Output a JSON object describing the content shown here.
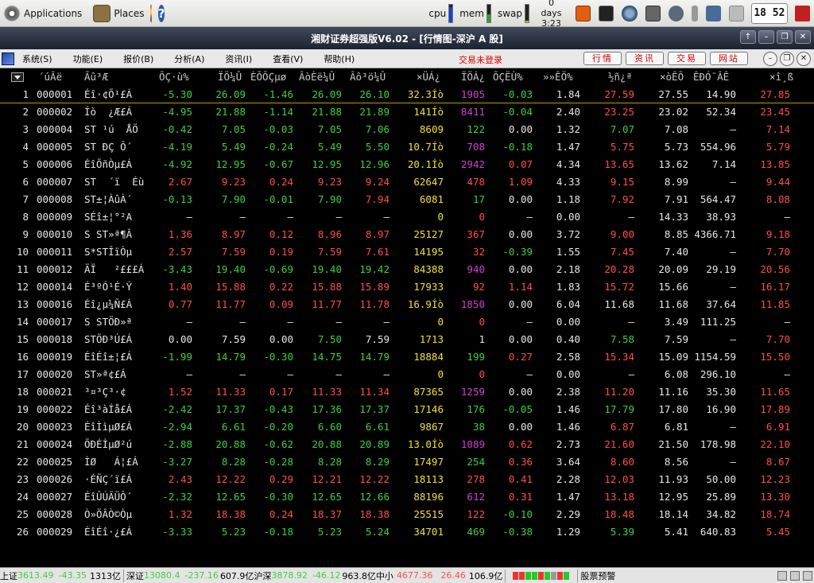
{
  "panel": {
    "applications": "Applications",
    "places": "Places",
    "cpu": "cpu",
    "mem": "mem",
    "swap": "swap",
    "uptime_days": "0 days",
    "uptime_time": "3:23",
    "clock": "18 52"
  },
  "window": {
    "title": "湘财证券超强版V6.02 - [行情图-深沪 A 股]",
    "buttons": [
      "↑",
      "–",
      "❐",
      "✕"
    ]
  },
  "menu": {
    "items": [
      "系统(S)",
      "功能(E)",
      "报价(B)",
      "分析(A)",
      "资讯(I)",
      "查看(V)",
      "帮助(H)"
    ],
    "login_status": "交易未登录",
    "right_buttons": [
      "行情",
      "资讯",
      "交易",
      "网站"
    ],
    "win_buttons": [
      "–",
      "❐",
      "✕"
    ]
  },
  "table": {
    "headers": [
      "´úÂë",
      "Ãû³Æ",
      "ÕÇ·ù%",
      "ÏÖ¼Û",
      "ÈÕÕÇµø",
      "ÂòÈë¼Û",
      "Âô³ö¼Û",
      "×ÜÁ¿",
      "ÏÖÁ¿",
      "ÕÇËÙ%",
      "»»ÊÖ%",
      "½ñ¿ª",
      "×òÊÕ",
      "ÊÐÓ¯ÂÊ",
      "×î¸ß"
    ],
    "rows": [
      [
        "1",
        "000001",
        "Éî·¢Õ¹£Á",
        "-5.30",
        "26.09",
        "-1.46",
        "26.09",
        "26.10",
        "32.3Íò",
        "1905",
        "-0.03",
        "1.84",
        "27.59",
        "27.55",
        "14.90",
        "27.85"
      ],
      [
        "2",
        "000002",
        "Íò  ¿Æ£Á",
        "-4.95",
        "21.88",
        "-1.14",
        "21.88",
        "21.89",
        "141Íò",
        "8411",
        "-0.04",
        "2.40",
        "23.25",
        "23.02",
        "52.34",
        "23.45"
      ],
      [
        "3",
        "000004",
        "ST ¹ú  ÅÖ",
        "-0.42",
        "7.05",
        "-0.03",
        "7.05",
        "7.06",
        "8609",
        "122",
        "0.00",
        "1.32",
        "7.07",
        "7.08",
        "—",
        "7.14"
      ],
      [
        "4",
        "000005",
        "ST ÐÇ Ô´",
        "-4.19",
        "5.49",
        "-0.24",
        "5.49",
        "5.50",
        "10.7Íò",
        "708",
        "-0.18",
        "1.47",
        "5.75",
        "5.73",
        "554.96",
        "5.79"
      ],
      [
        "5",
        "000006",
        "ÉîÕñÒµ£Á",
        "-4.92",
        "12.95",
        "-0.67",
        "12.95",
        "12.96",
        "20.1Íò",
        "2942",
        "0.07",
        "4.34",
        "13.65",
        "13.62",
        "7.14",
        "13.85"
      ],
      [
        "6",
        "000007",
        "ST  ´ï  Éù",
        "2.67",
        "9.23",
        "0.24",
        "9.23",
        "9.24",
        "62647",
        "478",
        "1.09",
        "4.33",
        "9.15",
        "8.99",
        "—",
        "9.44"
      ],
      [
        "7",
        "000008",
        "ST±¦ÀûÀ´",
        "-0.13",
        "7.90",
        "-0.01",
        "7.90",
        "7.94",
        "6081",
        "17",
        "0.00",
        "1.18",
        "7.92",
        "7.91",
        "564.47",
        "8.08"
      ],
      [
        "8",
        "000009",
        "SÉî±¦°²A",
        "—",
        "—",
        "—",
        "—",
        "—",
        "0",
        "0",
        "—",
        "0.00",
        "—",
        "14.33",
        "38.93",
        "—"
      ],
      [
        "9",
        "000010",
        "S ST»ª¶Â",
        "1.36",
        "8.97",
        "0.12",
        "8.96",
        "8.97",
        "25127",
        "367",
        "0.00",
        "3.72",
        "9.00",
        "8.85",
        "4366.71",
        "9.18"
      ],
      [
        "10",
        "000011",
        "S*STÎïÒµ",
        "2.57",
        "7.59",
        "0.19",
        "7.59",
        "7.61",
        "14195",
        "32",
        "-0.39",
        "1.55",
        "7.45",
        "7.40",
        "—",
        "7.70"
      ],
      [
        "11",
        "000012",
        "ÄÏ   ²£££Á",
        "-3.43",
        "19.40",
        "-0.69",
        "19.40",
        "19.42",
        "84388",
        "940",
        "0.00",
        "2.18",
        "20.28",
        "20.09",
        "29.19",
        "20.56"
      ],
      [
        "12",
        "000014",
        "É³ºÓ¹É·Ý",
        "1.40",
        "15.88",
        "0.22",
        "15.88",
        "15.89",
        "17933",
        "92",
        "1.14",
        "1.83",
        "15.72",
        "15.66",
        "—",
        "16.17"
      ],
      [
        "13",
        "000016",
        "Éî¿µ¼Ñ£Á",
        "0.77",
        "11.77",
        "0.09",
        "11.77",
        "11.78",
        "16.9Íò",
        "1850",
        "0.00",
        "6.04",
        "11.68",
        "11.68",
        "37.64",
        "11.85"
      ],
      [
        "14",
        "000017",
        "S STÖÐ»ª",
        "—",
        "—",
        "—",
        "—",
        "—",
        "0",
        "0",
        "—",
        "0.00",
        "—",
        "3.49",
        "111.25",
        "—"
      ],
      [
        "15",
        "000018",
        "STÖÐ³Ú£Á",
        "0.00",
        "7.59",
        "0.00",
        "7.50",
        "7.59",
        "1713",
        "1",
        "0.00",
        "0.40",
        "7.58",
        "7.59",
        "—",
        "7.70"
      ],
      [
        "16",
        "000019",
        "ÉîÉî±¦£Á",
        "-1.99",
        "14.79",
        "-0.30",
        "14.75",
        "14.79",
        "18884",
        "199",
        "0.27",
        "2.58",
        "15.34",
        "15.09",
        "1154.59",
        "15.50"
      ],
      [
        "17",
        "000020",
        "ST»ª¢£Á",
        "—",
        "—",
        "—",
        "—",
        "—",
        "0",
        "0",
        "—",
        "0.00",
        "—",
        "6.08",
        "296.10",
        "—"
      ],
      [
        "18",
        "000021",
        "³¤³Ç³·¢",
        "1.52",
        "11.33",
        "0.17",
        "11.33",
        "11.34",
        "87365",
        "1259",
        "0.00",
        "2.38",
        "11.20",
        "11.16",
        "35.30",
        "11.65"
      ],
      [
        "19",
        "000022",
        "Éî³àÍå£Á",
        "-2.42",
        "17.37",
        "-0.43",
        "17.36",
        "17.37",
        "17146",
        "176",
        "-0.05",
        "1.46",
        "17.79",
        "17.80",
        "16.90",
        "17.89"
      ],
      [
        "20",
        "000023",
        "ÉîÌìµØ£Á",
        "-2.94",
        "6.61",
        "-0.20",
        "6.60",
        "6.61",
        "9867",
        "38",
        "0.00",
        "1.46",
        "6.87",
        "6.81",
        "—",
        "6.91"
      ],
      [
        "21",
        "000024",
        "ÕÐÉÌµØ²ú",
        "-2.88",
        "20.88",
        "-0.62",
        "20.88",
        "20.89",
        "13.0Íò",
        "1089",
        "0.62",
        "2.73",
        "21.60",
        "21.50",
        "178.98",
        "22.10"
      ],
      [
        "22",
        "000025",
        "ÌØ   Á¦£Á",
        "-3.27",
        "8.28",
        "-0.28",
        "8.28",
        "8.29",
        "17497",
        "254",
        "0.36",
        "3.64",
        "8.60",
        "8.56",
        "—",
        "8.67"
      ],
      [
        "23",
        "000026",
        "·ÉÑÇ´ï£Á",
        "2.43",
        "12.22",
        "0.29",
        "12.21",
        "12.22",
        "18113",
        "278",
        "0.41",
        "2.28",
        "12.03",
        "11.93",
        "50.00",
        "12.23"
      ],
      [
        "24",
        "000027",
        "ÉîÛÚÄÜÔ´",
        "-2.32",
        "12.65",
        "-0.30",
        "12.65",
        "12.66",
        "88196",
        "612",
        "0.31",
        "1.47",
        "13.18",
        "12.95",
        "25.89",
        "13.30"
      ],
      [
        "25",
        "000028",
        "Ò»ÖÂÒ©Òµ",
        "1.32",
        "18.38",
        "0.24",
        "18.37",
        "18.38",
        "25515",
        "122",
        "-0.10",
        "2.29",
        "18.48",
        "18.14",
        "34.82",
        "18.74"
      ],
      [
        "26",
        "000029",
        "ÉîÉî·¿£Á",
        "-3.33",
        "5.23",
        "-0.18",
        "5.23",
        "5.24",
        "34701",
        "469",
        "-0.38",
        "1.29",
        "5.39",
        "5.41",
        "640.83",
        "5.45"
      ]
    ]
  },
  "statusbar": {
    "sh_label": "上证",
    "sh_index": "3613.49",
    "sh_change": "-43.35",
    "sh_amount": "1313亿",
    "sz_label": "深证",
    "sz_index": "13080.4",
    "sz_change": "-237.16",
    "sz_amount": "607.9亿",
    "hs_label": "沪深",
    "hs_index": "3878.92",
    "hs_change": "-46.12",
    "hs_amount": "963.8亿",
    "zx_label": "中小",
    "zx_index": "4677.36",
    "zx_change": "26.46",
    "zx_amount": "106.9亿",
    "alert": "股票预警"
  },
  "colors": {
    "up": "#ff4d4d",
    "down": "#3cd13c",
    "flat": "#e6e6e6",
    "volume": "#f0e030",
    "current_volume": "#d040d0"
  }
}
